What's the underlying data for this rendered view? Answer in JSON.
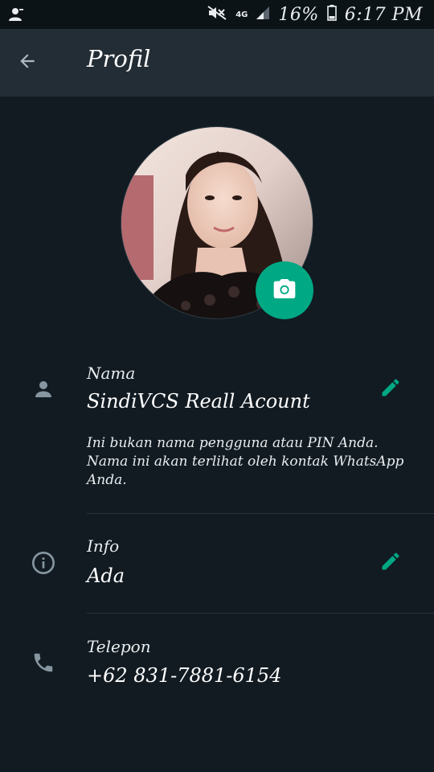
{
  "status_bar": {
    "network": "4G",
    "battery": "16%",
    "time": "6:17 PM"
  },
  "app_bar": {
    "title": "Profil"
  },
  "name_section": {
    "label": "Nama",
    "value": "SindiVCS Reall Acount",
    "hint": "Ini bukan nama pengguna atau PIN Anda. Nama ini akan terlihat oleh kontak WhatsApp Anda."
  },
  "info_section": {
    "label": "Info",
    "value": "Ada"
  },
  "phone_section": {
    "label": "Telepon",
    "value": "+62 831-7881-6154"
  },
  "colors": {
    "background": "#121b22",
    "app_bar": "#232d36",
    "accent": "#00a884",
    "icon_gray": "#8696a0"
  }
}
